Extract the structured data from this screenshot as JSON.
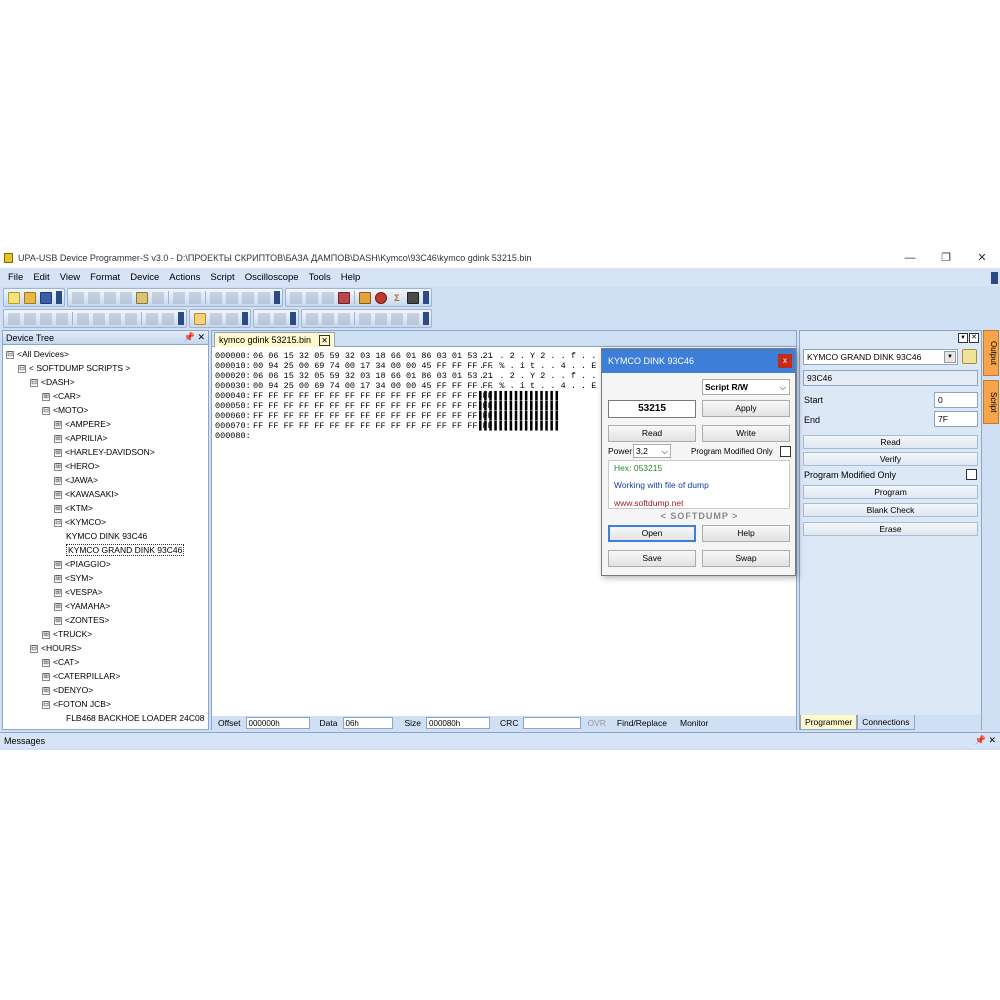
{
  "window": {
    "title": "UPA-USB Device Programmer-S v3.0 - D:\\ПРОЕКТЫ СКРИПТОВ\\БАЗА ДАМПОВ\\DASH\\Kymco\\93C46\\kymco gdink 53215.bin",
    "min": "—",
    "max": "❐",
    "close": "✕"
  },
  "menu": [
    "File",
    "Edit",
    "View",
    "Format",
    "Device",
    "Actions",
    "Script",
    "Oscilloscope",
    "Tools",
    "Help"
  ],
  "device_tree": {
    "title": "Device Tree",
    "pin": "📌 ✕",
    "nodes": [
      {
        "label": "<All Devices>",
        "exp": "⊟",
        "indent": 0
      },
      {
        "label": "< SOFTDUMP SCRIPTS >",
        "exp": "⊟",
        "indent": 1
      },
      {
        "label": "<DASH>",
        "exp": "⊟",
        "indent": 2
      },
      {
        "label": "<CAR>",
        "exp": "⊞",
        "indent": 3
      },
      {
        "label": "<MOTO>",
        "exp": "⊟",
        "indent": 3
      },
      {
        "label": "<AMPERE>",
        "exp": "⊞",
        "indent": 4
      },
      {
        "label": "<APRILIA>",
        "exp": "⊞",
        "indent": 4
      },
      {
        "label": "<HARLEY-DAVIDSON>",
        "exp": "⊞",
        "indent": 4
      },
      {
        "label": "<HERO>",
        "exp": "⊞",
        "indent": 4
      },
      {
        "label": "<JAWA>",
        "exp": "⊞",
        "indent": 4
      },
      {
        "label": "<KAWASAKI>",
        "exp": "⊞",
        "indent": 4
      },
      {
        "label": "<KTM>",
        "exp": "⊞",
        "indent": 4
      },
      {
        "label": "<KYMCO>",
        "exp": "⊟",
        "indent": 4
      },
      {
        "label": "KYMCO DINK 93C46",
        "exp": "",
        "indent": 5
      },
      {
        "label": "KYMCO GRAND DINK 93C46",
        "exp": "",
        "indent": 5,
        "selected": true
      },
      {
        "label": "<PIAGGIO>",
        "exp": "⊞",
        "indent": 4
      },
      {
        "label": "<SYM>",
        "exp": "⊞",
        "indent": 4
      },
      {
        "label": "<VESPA>",
        "exp": "⊞",
        "indent": 4
      },
      {
        "label": "<YAMAHA>",
        "exp": "⊞",
        "indent": 4
      },
      {
        "label": "<ZONTES>",
        "exp": "⊞",
        "indent": 4
      },
      {
        "label": "<TRUCK>",
        "exp": "⊞",
        "indent": 3
      },
      {
        "label": "<HOURS>",
        "exp": "⊟",
        "indent": 2
      },
      {
        "label": "<CAT>",
        "exp": "⊞",
        "indent": 3
      },
      {
        "label": "<CATERPILLAR>",
        "exp": "⊞",
        "indent": 3
      },
      {
        "label": "<DENYO>",
        "exp": "⊞",
        "indent": 3
      },
      {
        "label": "<FOTON JCB>",
        "exp": "⊟",
        "indent": 3
      },
      {
        "label": "FLB468 BACKHOE LOADER 24C08",
        "exp": "",
        "indent": 5
      }
    ]
  },
  "editor": {
    "tab": "kymco gdink 53215.bin",
    "tab_close": "✕",
    "rows": [
      {
        "addr": "000000:",
        "hex": "06 06 15 32 05 59 32 03 18 66 01 86 03 01 53 21",
        "ascii": ". . . 2 . Y 2 . . f . . . . S !"
      },
      {
        "addr": "000010:",
        "hex": "00 94 25 00 69 74 00 17 34 00 00 45 FF FF FF FF",
        "ascii": ". . % . i t . . 4 . . E ▌▌▌▌"
      },
      {
        "addr": "000020:",
        "hex": "06 06 15 32 05 59 32 03 18 66 01 86 03 01 53 21",
        "ascii": ". . . 2 . Y 2 . . f . . . . S !"
      },
      {
        "addr": "000030:",
        "hex": "00 94 25 00 69 74 00 17 34 00 00 45 FF FF FF FF",
        "ascii": ". . % . i t . . 4 . . E ▌▌▌▌"
      },
      {
        "addr": "000040:",
        "hex": "FF FF FF FF FF FF FF FF FF FF FF FF FF FF FF FF",
        "ascii": "▌▌▌▌▌▌▌▌▌▌▌▌▌▌▌▌"
      },
      {
        "addr": "000050:",
        "hex": "FF FF FF FF FF FF FF FF FF FF FF FF FF FF FF FF",
        "ascii": "▌▌▌▌▌▌▌▌▌▌▌▌▌▌▌▌"
      },
      {
        "addr": "000060:",
        "hex": "FF FF FF FF FF FF FF FF FF FF FF FF FF FF FF FF",
        "ascii": "▌▌▌▌▌▌▌▌▌▌▌▌▌▌▌▌"
      },
      {
        "addr": "000070:",
        "hex": "FF FF FF FF FF FF FF FF FF FF FF FF FF FF FF FF",
        "ascii": "▌▌▌▌▌▌▌▌▌▌▌▌▌▌▌▌"
      },
      {
        "addr": "000080:",
        "hex": "",
        "ascii": ""
      }
    ]
  },
  "status": {
    "offset_label": "Offset",
    "offset": "000000h",
    "data_label": "Data",
    "data": "06h",
    "size_label": "Size",
    "size": "000080h",
    "crc_label": "CRC",
    "crc": "",
    "ovr": "OVR",
    "find": "Find/Replace",
    "monitor": "Monitor"
  },
  "dialog": {
    "title": "KYMCO DINK 93C46",
    "close": "x",
    "mode": "Script R/W",
    "value": "53215",
    "apply": "Apply",
    "read": "Read",
    "write": "Write",
    "power_label": "Power",
    "power": "3,2",
    "pmo": "Program Modified Only",
    "hex": "Hex: 053215",
    "info": "Working with file of dump",
    "url": "www.softdump.net",
    "brand": "< SOFTDUMP >",
    "open": "Open",
    "help": "Help",
    "save": "Save",
    "swap": "Swap"
  },
  "programmer": {
    "device": "KYMCO GRAND DINK 93C46",
    "chip": "93C46",
    "start_label": "Start",
    "start": "0",
    "end_label": "End",
    "end": "7F",
    "read": "Read",
    "verify": "Verify",
    "pmo": "Program Modified Only",
    "program": "Program",
    "blank": "Blank Check",
    "erase": "Erase",
    "tab_programmer": "Programmer",
    "tab_connections": "Connections"
  },
  "side_tabs": [
    "Output",
    "Script"
  ],
  "messages": {
    "label": "Messages",
    "pin": "📌 ✕"
  },
  "colors": {
    "accent": "#3d7fd8",
    "workspace": "#cfe0f5",
    "tab_active": "#fff8cc",
    "side_tab": "#f7a44a"
  }
}
